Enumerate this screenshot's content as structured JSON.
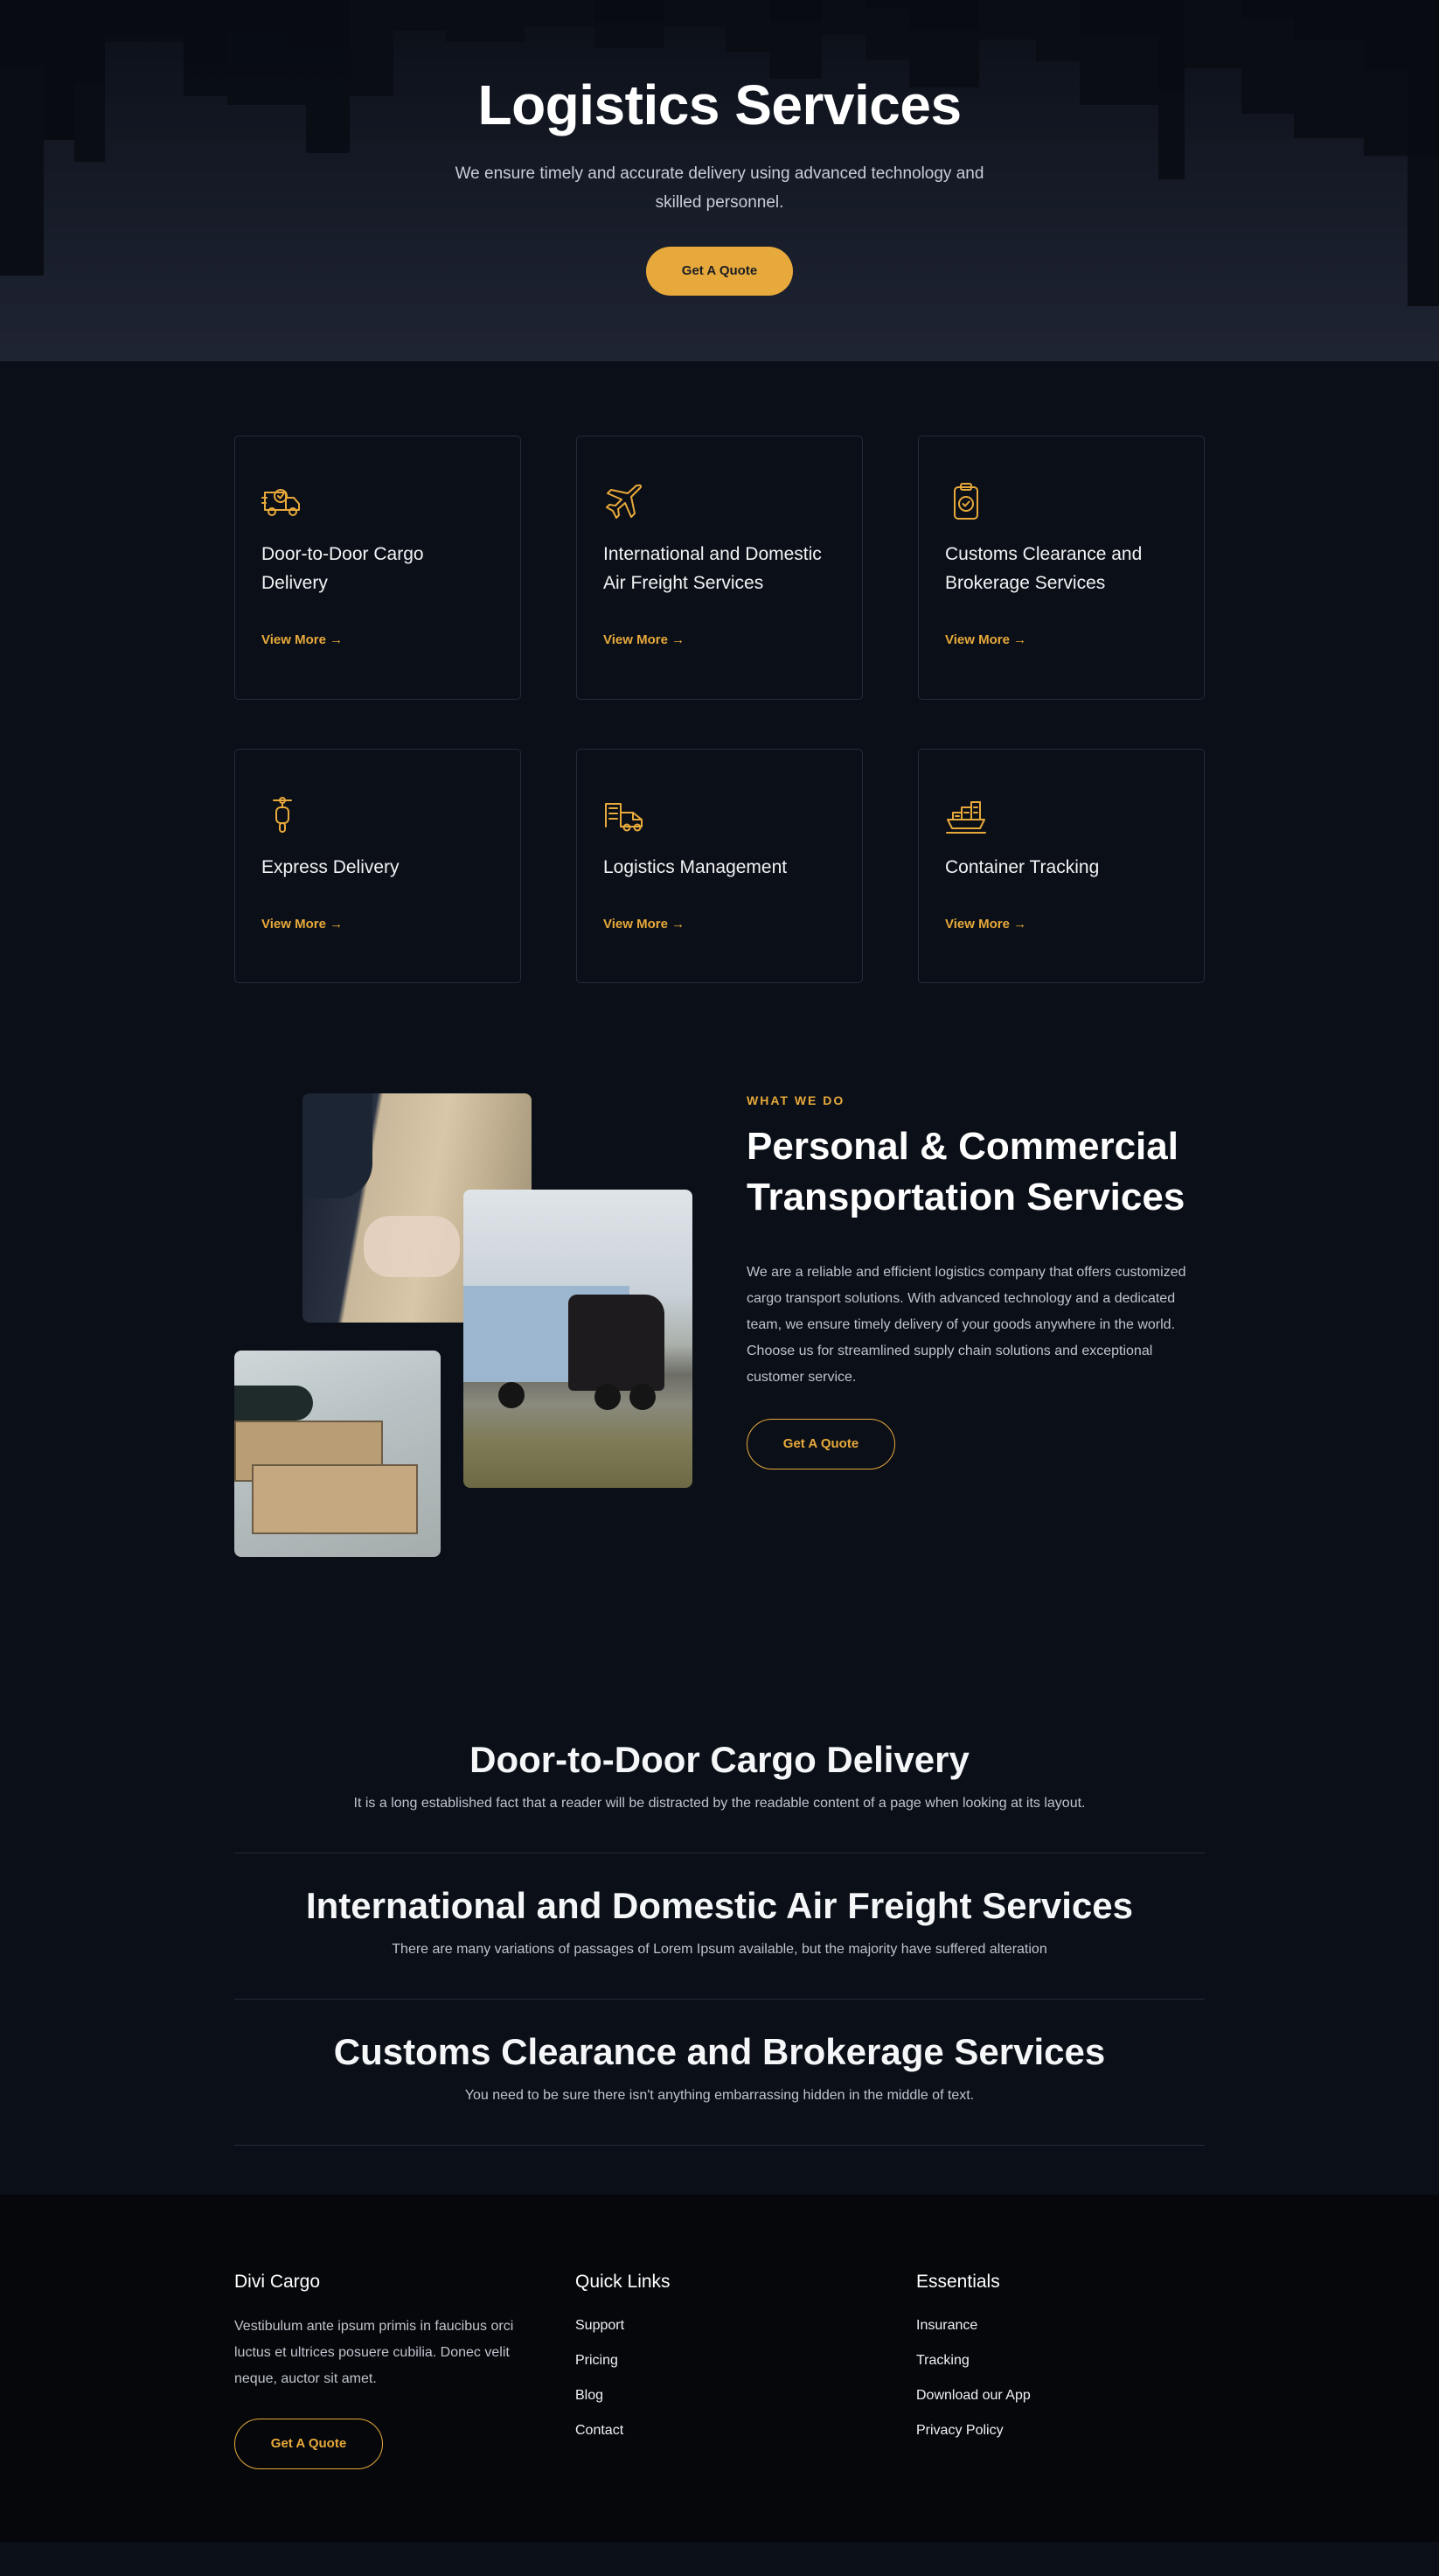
{
  "hero": {
    "title": "Logistics Services",
    "subtitle": "We ensure timely and accurate delivery using advanced technology and skilled personnel.",
    "cta_label": "Get A Quote"
  },
  "services": [
    {
      "title": "Door-to-Door Cargo Delivery",
      "link_label": "View More",
      "icon": "delivery-truck-icon"
    },
    {
      "title": "International and Domestic Air Freight Services",
      "link_label": "View More",
      "icon": "airplane-icon"
    },
    {
      "title": "Customs Clearance and Brokerage Services",
      "link_label": "View More",
      "icon": "clipboard-check-icon"
    },
    {
      "title": "Express Delivery",
      "link_label": "View More",
      "icon": "scooter-icon"
    },
    {
      "title": "Logistics Management",
      "link_label": "View More",
      "icon": "warehouse-truck-icon"
    },
    {
      "title": "Container Tracking",
      "link_label": "View More",
      "icon": "cargo-ship-icon"
    }
  ],
  "link_arrow": "→",
  "what_we_do": {
    "eyebrow": "WHAT WE DO",
    "heading": "Personal & Commercial Transportation Services",
    "body": "We are a reliable and efficient logistics company that offers customized cargo transport solutions. With advanced technology and a dedicated team, we ensure timely delivery of your goods anywhere in the world. Choose us for streamlined supply chain solutions and exceptional customer service.",
    "cta_label": "Get A Quote"
  },
  "service_list": [
    {
      "title": "Door-to-Door Cargo Delivery",
      "text": "It is a long established fact that a reader will be distracted by the readable content of a page when looking at its layout."
    },
    {
      "title": "International and Domestic Air Freight Services",
      "text": "There are many variations of passages of Lorem Ipsum available, but the majority have suffered alteration"
    },
    {
      "title": "Customs Clearance and Brokerage Services",
      "text": "You need to be sure there isn't anything embarrassing hidden in the middle of text."
    }
  ],
  "footer": {
    "brand": "Divi Cargo",
    "description": "Vestibulum ante ipsum primis in faucibus orci luctus et ultrices posuere cubilia. Donec velit neque, auctor sit amet.",
    "cta_label": "Get A Quote",
    "quick_links_title": "Quick Links",
    "quick_links": [
      "Support",
      "Pricing",
      "Blog",
      "Contact"
    ],
    "essentials_title": "Essentials",
    "essentials": [
      "Insurance",
      "Tracking",
      "Download our App",
      "Privacy Policy"
    ]
  },
  "colors": {
    "accent": "#e7a93b",
    "background": "#0b0f17",
    "footer_background": "#05070b",
    "card_border": "#262b36"
  }
}
